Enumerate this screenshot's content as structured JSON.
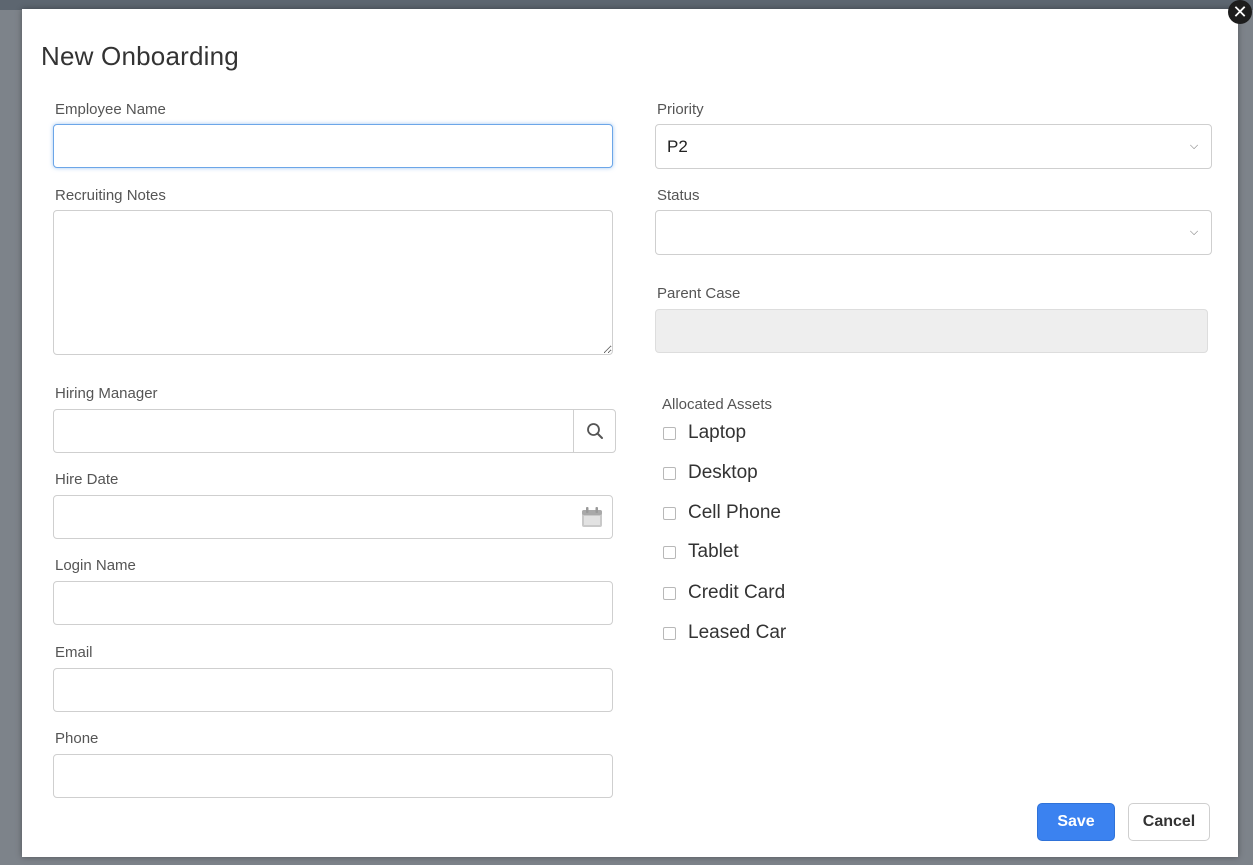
{
  "dialog": {
    "title": "New Onboarding",
    "close_glyph": "✕"
  },
  "form": {
    "employee_name": {
      "label": "Employee Name",
      "value": ""
    },
    "recruiting_notes": {
      "label": "Recruiting Notes",
      "value": ""
    },
    "hiring_manager": {
      "label": "Hiring Manager",
      "value": "",
      "icon": "search-icon"
    },
    "hire_date": {
      "label": "Hire Date",
      "value": "",
      "icon": "calendar-icon"
    },
    "login_name": {
      "label": "Login Name",
      "value": ""
    },
    "email": {
      "label": "Email",
      "value": ""
    },
    "phone": {
      "label": "Phone",
      "value": ""
    },
    "priority": {
      "label": "Priority",
      "value": "P2"
    },
    "status": {
      "label": "Status",
      "value": ""
    },
    "parent_case": {
      "label": "Parent Case",
      "value": ""
    },
    "allocated_assets": {
      "label": "Allocated Assets",
      "items": [
        {
          "label": "Laptop",
          "checked": false
        },
        {
          "label": "Desktop",
          "checked": false
        },
        {
          "label": "Cell Phone",
          "checked": false
        },
        {
          "label": "Tablet",
          "checked": false
        },
        {
          "label": "Credit Card",
          "checked": false
        },
        {
          "label": "Leased Car",
          "checked": false
        }
      ]
    }
  },
  "actions": {
    "save_label": "Save",
    "cancel_label": "Cancel"
  },
  "colors": {
    "primary": "#3b82f0",
    "focus_border": "#6ca6e8",
    "disabled_bg": "#eeeeee"
  }
}
